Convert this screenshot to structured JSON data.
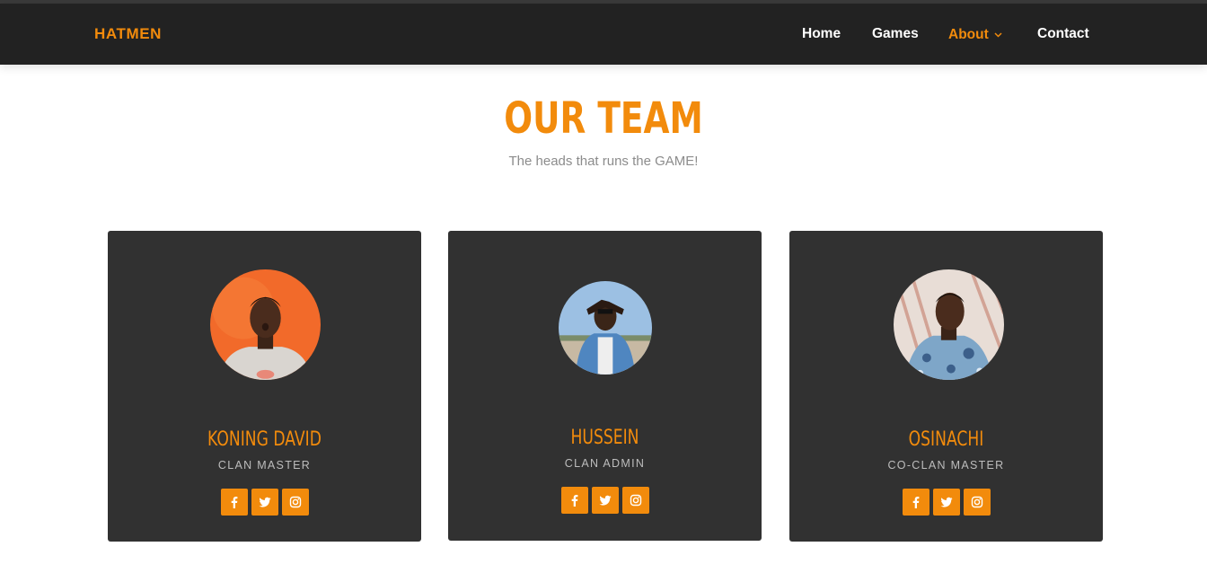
{
  "header": {
    "brand": "HATMEN",
    "nav": [
      {
        "label": "Home",
        "active": false
      },
      {
        "label": "Games",
        "active": false
      },
      {
        "label": "About",
        "active": true,
        "dropdown": true
      },
      {
        "label": "Contact",
        "active": false
      }
    ]
  },
  "team": {
    "title": "OUR TEAM",
    "subtitle": "The heads that runs the GAME!",
    "members": [
      {
        "name": "KONING DAVID",
        "role": "CLAN MASTER",
        "socials": [
          "facebook-icon",
          "twitter-icon",
          "instagram-icon"
        ]
      },
      {
        "name": "HUSSEIN",
        "role": "CLAN ADMIN",
        "socials": [
          "facebook-icon",
          "twitter-icon",
          "instagram-icon"
        ]
      },
      {
        "name": "OSINACHI",
        "role": "CO-CLAN MASTER",
        "socials": [
          "facebook-icon",
          "twitter-icon",
          "instagram-icon"
        ]
      }
    ]
  },
  "colors": {
    "accent": "#f28b0c",
    "navbar": "#222222",
    "card": "#313131",
    "page": "#ffffff"
  }
}
